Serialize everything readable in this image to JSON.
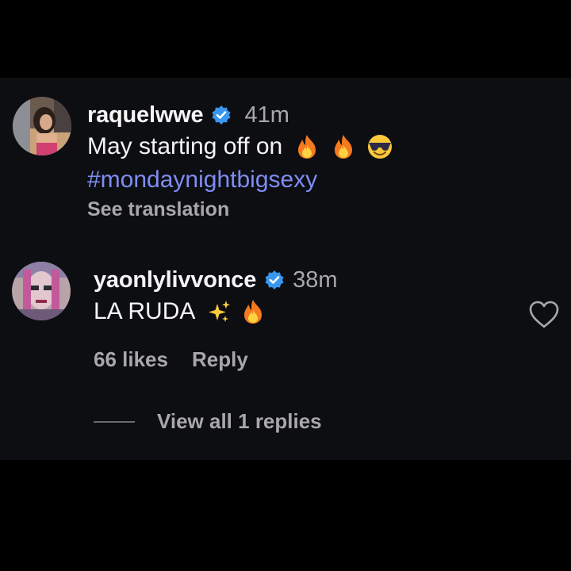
{
  "comments": [
    {
      "username": "raquelwwe",
      "verified": true,
      "time": "41m",
      "text": "May starting off on",
      "emojis": [
        "fire-emoji",
        "fire-emoji",
        "sunglasses-emoji"
      ],
      "hashtag": "#mondaynightbigsexy",
      "translation_label": "See translation"
    },
    {
      "username": "yaonlylivvonce",
      "verified": true,
      "time": "38m",
      "text": "LA RUDA",
      "emojis": [
        "sparkles-emoji",
        "fire-emoji"
      ],
      "likes": "66 likes",
      "reply_label": "Reply",
      "view_replies_label": "View all 1 replies",
      "like_icon": "heart-outline-icon"
    }
  ],
  "colors": {
    "background": "#000000",
    "panel": "#0d0e12",
    "text": "#f5f5f5",
    "muted": "#a8a8a8",
    "hashtag": "#7f8df3",
    "verified": "#3897f0"
  }
}
